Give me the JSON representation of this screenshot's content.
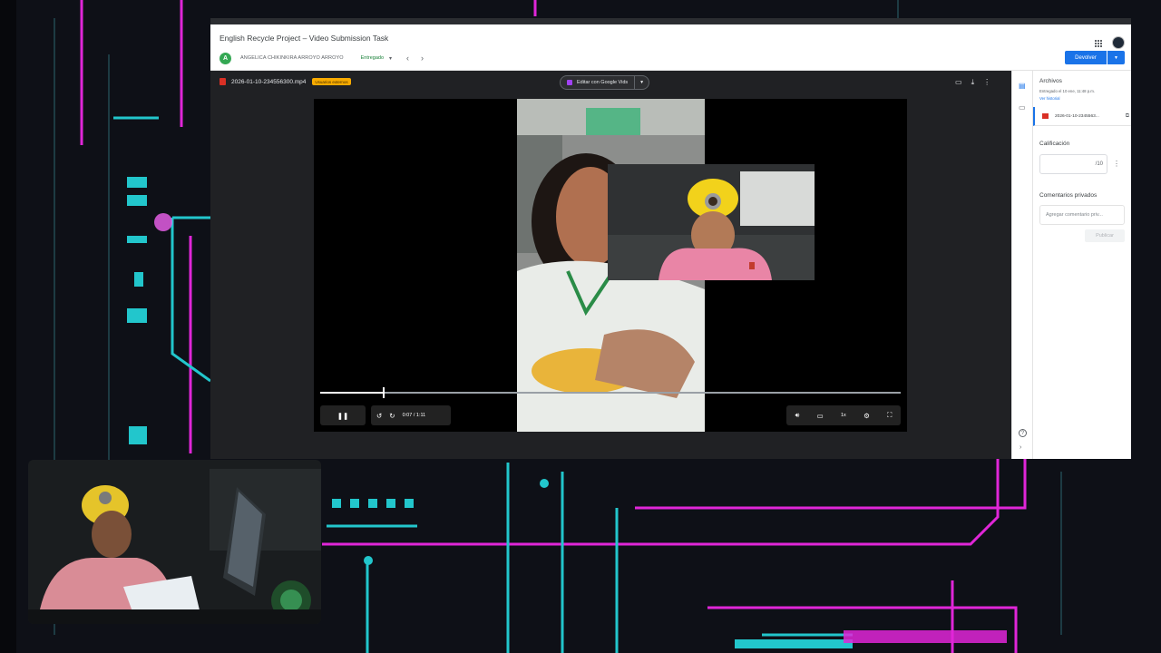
{
  "classroom": {
    "assignment_title": "English Recycle Project – Video Submission Task",
    "student": {
      "initial": "A",
      "name": "ANGELICA CHIKINKIRA ARROYO ARROYO",
      "status": "Entregado"
    },
    "return_button": "Devolver"
  },
  "viewer": {
    "file_name": "2026-01-10-234556300.mp4",
    "external_badge": "Usuarios externos",
    "edit_button": "Editar con Google Vids"
  },
  "player": {
    "current_time": "0:07",
    "duration": "1:11",
    "time_display": "0:07 / 1:11",
    "progress": 0.11,
    "speed": "1x"
  },
  "side_panel": {
    "files_title": "Archivos",
    "submitted_info": "Entregado el 10 ene, 11:48 p.m.",
    "history_link": "Ver historial",
    "attachment_name": "2026-01-10-2345563...",
    "grade_title": "Calificación",
    "grade_value": "",
    "grade_max": "/10",
    "private_comments_title": "Comentarios privados",
    "comment_placeholder": "Agregar comentario priv...",
    "post_button": "Publicar"
  },
  "colors": {
    "classroom_blue": "#1a73e8",
    "status_green": "#188038",
    "neon_pink": "#e026d8",
    "neon_cyan": "#20c8c8"
  }
}
